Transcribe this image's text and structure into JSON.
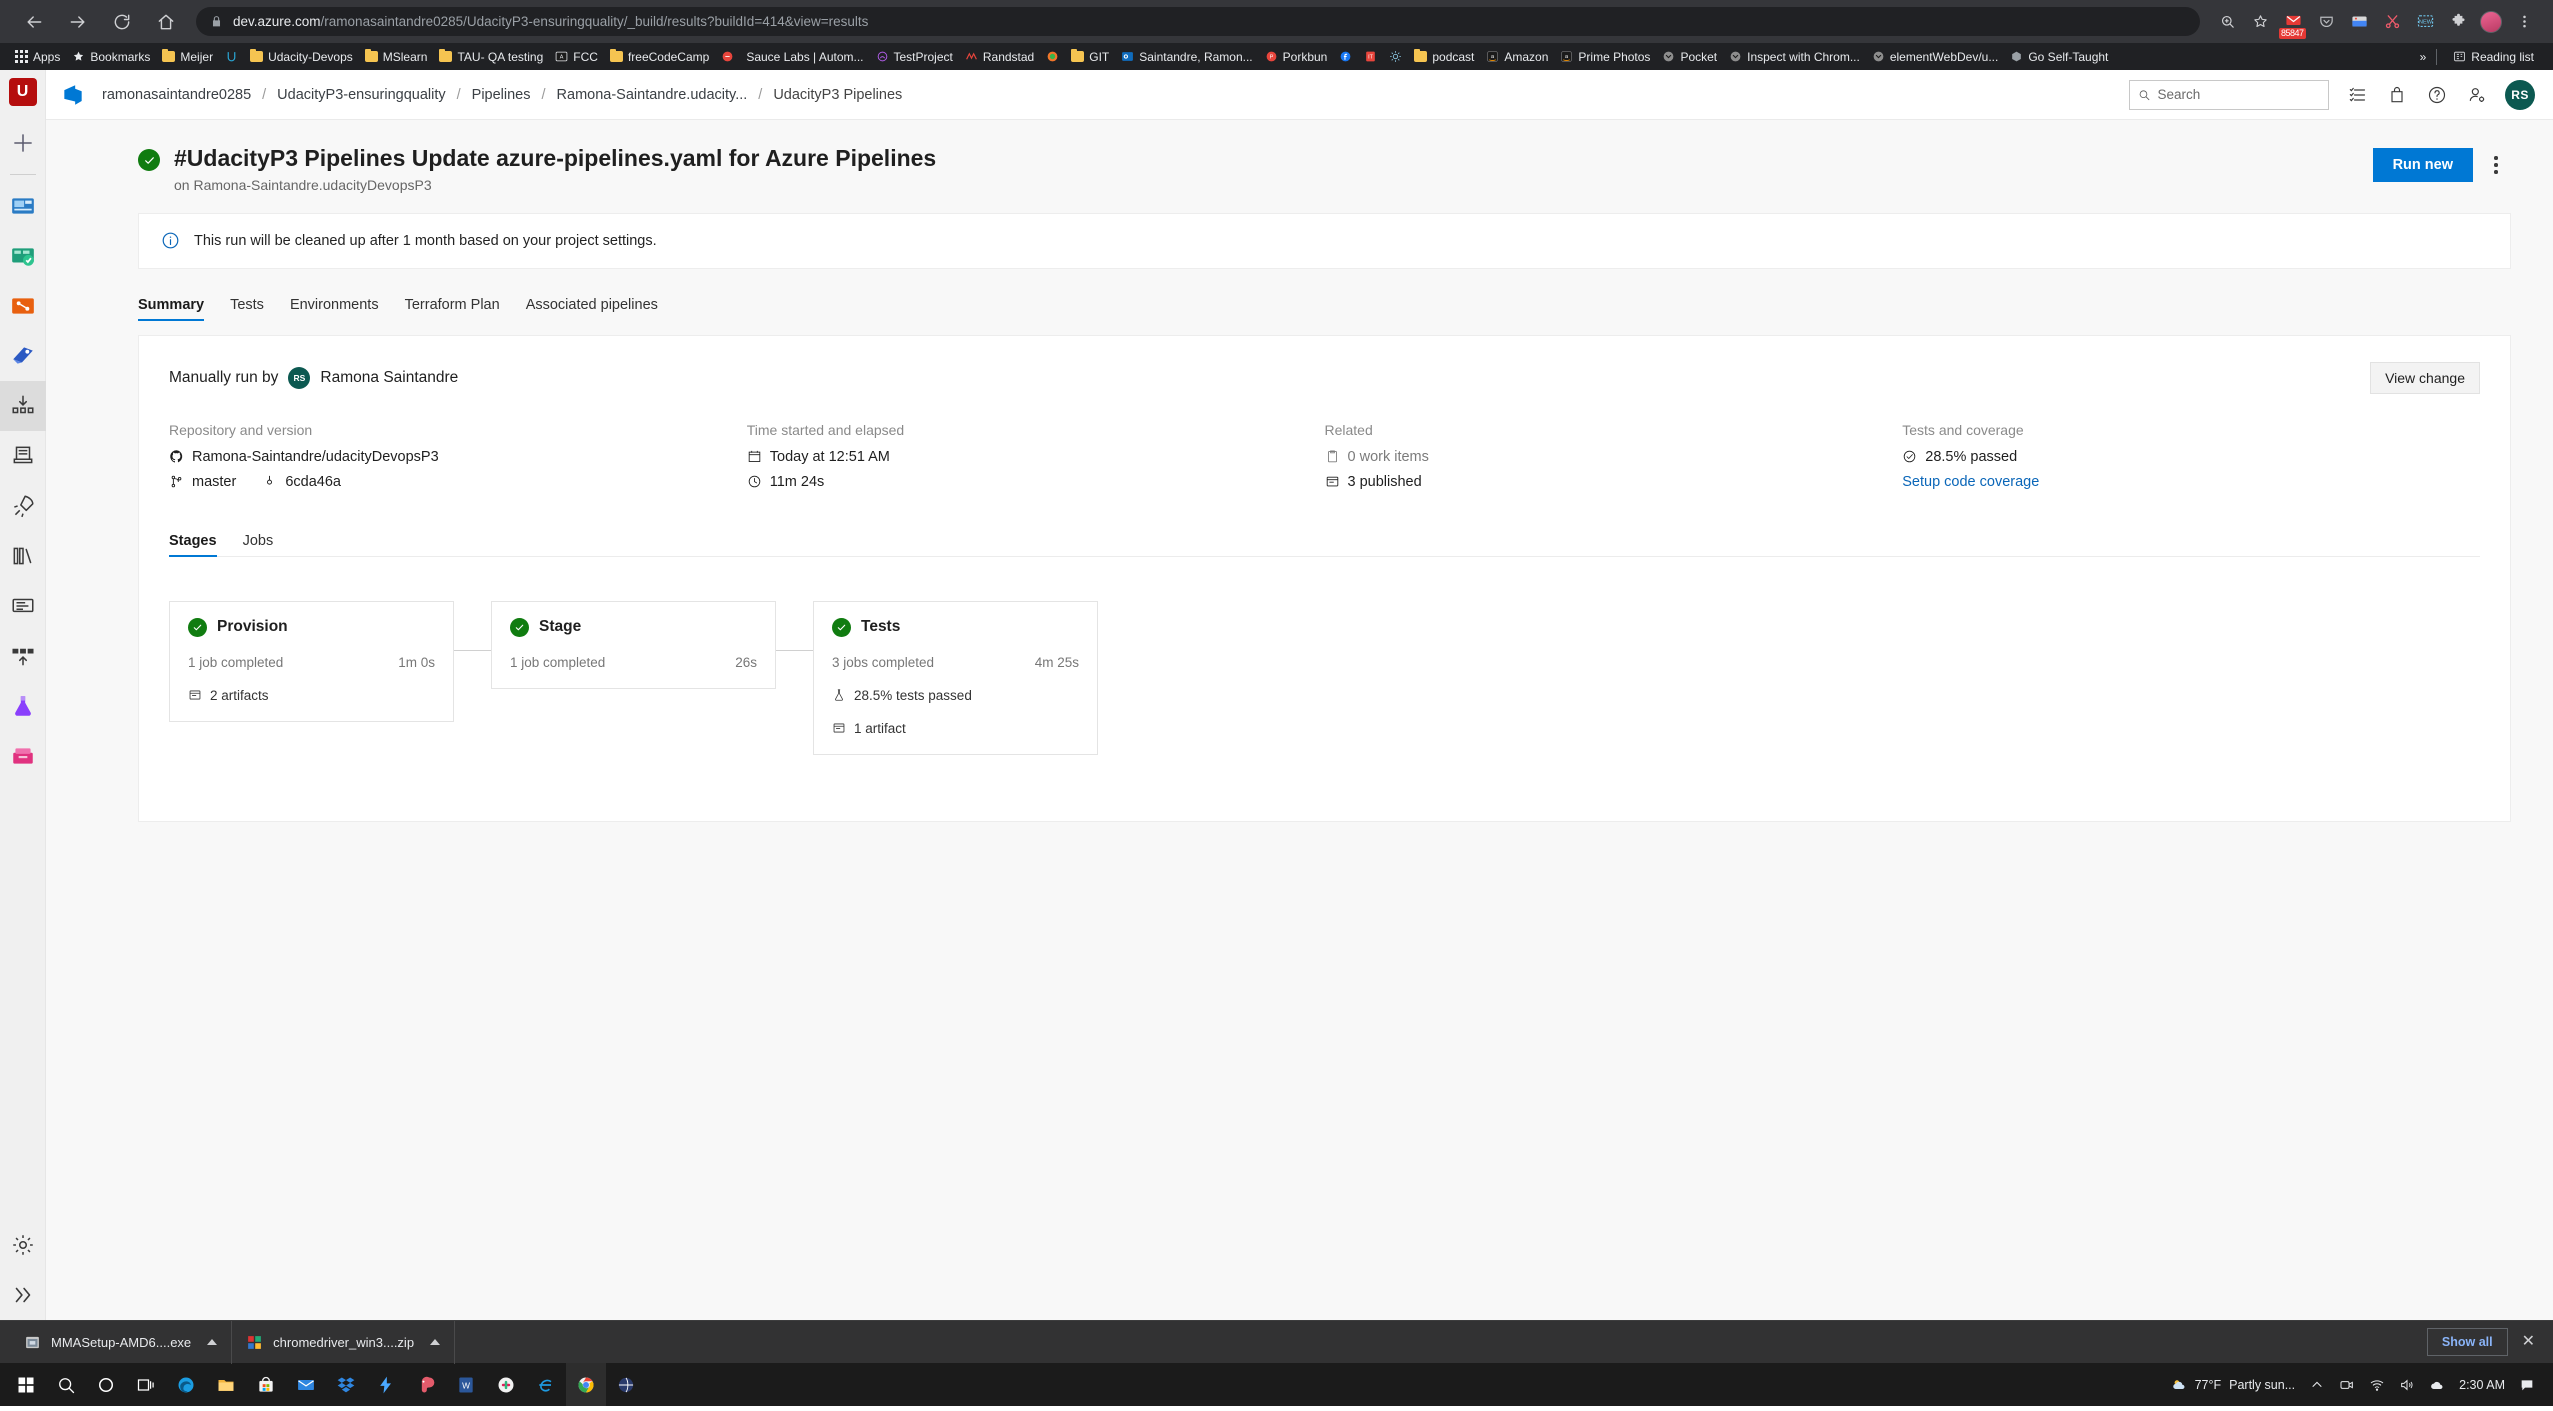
{
  "browser": {
    "url_host": "dev.azure.com",
    "url_path": "/ramonasaintandre0285/UdacityP3-ensuringquality/_build/results?buildId=414&view=results",
    "nav": {
      "back": "back-arrow",
      "forward": "forward-arrow",
      "reload": "reload",
      "home": "home"
    },
    "gmail_badge": "85847",
    "bookmarks": [
      {
        "label": "Apps",
        "icon": "apps-grid"
      },
      {
        "label": "Bookmarks",
        "icon": "star"
      },
      {
        "label": "Meijer",
        "icon": "folder"
      },
      {
        "label": "",
        "icon": "udacity"
      },
      {
        "label": "Udacity-Devops",
        "icon": "folder"
      },
      {
        "label": "MSlearn",
        "icon": "folder"
      },
      {
        "label": "TAU- QA testing",
        "icon": "folder"
      },
      {
        "label": "FCC",
        "icon": "fcc"
      },
      {
        "label": "freeCodeCamp",
        "icon": "folder"
      },
      {
        "label": "",
        "icon": "saucelabs"
      },
      {
        "label": "Sauce Labs | Autom...",
        "icon": "saucelabs"
      },
      {
        "label": "TestProject",
        "icon": "testproject"
      },
      {
        "label": "Randstad",
        "icon": "randstad"
      },
      {
        "label": "",
        "icon": "firefox"
      },
      {
        "label": "GIT",
        "icon": "folder"
      },
      {
        "label": "Saintandre, Ramon...",
        "icon": "outlook"
      },
      {
        "label": "Porkbun",
        "icon": "porkbun"
      },
      {
        "label": "",
        "icon": "facebook"
      },
      {
        "label": "",
        "icon": "it"
      },
      {
        "label": "",
        "icon": "gear-wheel"
      },
      {
        "label": "podcast",
        "icon": "folder"
      },
      {
        "label": "Amazon",
        "icon": "amazon"
      },
      {
        "label": "Prime Photos",
        "icon": "amazon"
      },
      {
        "label": "Pocket",
        "icon": "pocket"
      },
      {
        "label": "Inspect with Chrom...",
        "icon": "pocket"
      },
      {
        "label": "elementWebDev/u...",
        "icon": "pocket"
      },
      {
        "label": "Go Self-Taught",
        "icon": "cube"
      }
    ],
    "overflow_label": "»",
    "reading_list": "Reading list"
  },
  "rail": {
    "logo_letter": "U",
    "items": [
      {
        "name": "add-new",
        "icon": "plus"
      },
      {
        "name": "overview",
        "icon": "dashboard"
      },
      {
        "name": "boards",
        "icon": "boards"
      },
      {
        "name": "repos",
        "icon": "repos"
      },
      {
        "name": "pipelines",
        "icon": "pipelines"
      },
      {
        "name": "pipelines-runs",
        "icon": "pipeline-runs"
      },
      {
        "name": "environments",
        "icon": "environments"
      },
      {
        "name": "releases",
        "icon": "rocket"
      },
      {
        "name": "library",
        "icon": "library"
      },
      {
        "name": "task-groups",
        "icon": "task-groups"
      },
      {
        "name": "deployment-groups",
        "icon": "deployment-groups"
      },
      {
        "name": "test-plans",
        "icon": "flask"
      },
      {
        "name": "artifacts",
        "icon": "artifacts"
      }
    ],
    "settings": "gear-icon",
    "expand": "chevron-double-right"
  },
  "topbar": {
    "breadcrumbs": [
      "ramonasaintandre0285",
      "UdacityP3-ensuringquality",
      "Pipelines",
      "Ramona-Saintandre.udacity...",
      "UdacityP3 Pipelines"
    ],
    "separator": "/",
    "search_placeholder": "Search",
    "search_value": "",
    "icons": [
      "list-icon",
      "shopping-bag-icon",
      "help-icon",
      "user-settings-icon"
    ],
    "avatar_initials": "RS"
  },
  "page": {
    "status": "succeeded",
    "title": "#UdacityP3 Pipelines Update azure-pipelines.yaml for Azure Pipelines",
    "subtitle": "on Ramona-Saintandre.udacityDevopsP3",
    "run_new_label": "Run new",
    "info_message": "This run will be cleaned up after 1 month based on your project settings.",
    "tabs": [
      {
        "label": "Summary",
        "active": true
      },
      {
        "label": "Tests",
        "active": false
      },
      {
        "label": "Environments",
        "active": false
      },
      {
        "label": "Terraform Plan",
        "active": false
      },
      {
        "label": "Associated pipelines",
        "active": false
      }
    ]
  },
  "summary": {
    "run_by_prefix": "Manually run by",
    "run_by_initials": "RS",
    "run_by_name": "Ramona Saintandre",
    "view_change_label": "View change",
    "columns": [
      {
        "label": "Repository and version",
        "repo": "Ramona-Saintandre/udacityDevopsP3",
        "branch": "master",
        "commit": "6cda46a"
      },
      {
        "label": "Time started and elapsed",
        "started": "Today at 12:51 AM",
        "elapsed": "11m 24s"
      },
      {
        "label": "Related",
        "work_items": "0 work items",
        "published": "3 published"
      },
      {
        "label": "Tests and coverage",
        "tests": "28.5% passed",
        "coverage_link": "Setup code coverage"
      }
    ],
    "subtabs": [
      {
        "label": "Stages",
        "active": true
      },
      {
        "label": "Jobs",
        "active": false
      }
    ],
    "stages": [
      {
        "name": "Provision",
        "status": "succeeded",
        "jobs": "1 job completed",
        "duration": "1m 0s",
        "extras": [
          {
            "icon": "artifact-icon",
            "label": "2 artifacts"
          }
        ]
      },
      {
        "name": "Stage",
        "status": "succeeded",
        "jobs": "1 job completed",
        "duration": "26s",
        "extras": []
      },
      {
        "name": "Tests",
        "status": "succeeded",
        "jobs": "3 jobs completed",
        "duration": "4m 25s",
        "extras": [
          {
            "icon": "flask-icon",
            "label": "28.5% tests passed"
          },
          {
            "icon": "artifact-icon",
            "label": "1 artifact"
          }
        ]
      }
    ]
  },
  "shelf": {
    "downloads": [
      {
        "label": "MMASetup-AMD6....exe",
        "icon": "installer-icon"
      },
      {
        "label": "chromedriver_win3....zip",
        "icon": "winrar-icon"
      }
    ],
    "show_all_label": "Show all",
    "close_label": "✕"
  },
  "taskbar": {
    "items": [
      "start-icon",
      "search-icon",
      "cortana-icon",
      "task-view-icon",
      "edge-icon",
      "file-explorer-icon",
      "microsoft-store-icon",
      "mail-icon",
      "dropbox-icon",
      "lightning-icon",
      "paint-icon",
      "word-icon",
      "slack-icon",
      "internet-explorer-icon",
      "chrome-icon",
      "globe-icon"
    ],
    "weather_temp": "77°F",
    "weather_desc": "Partly sun...",
    "clock": "2:30 AM",
    "tray_icons": [
      "chevron-up-icon",
      "meet-icon",
      "wifi-icon",
      "volume-icon",
      "onedrive-icon"
    ],
    "notification_icon": "notification-icon"
  },
  "colors": {
    "accent": "#0078d4",
    "success": "#107c10",
    "link": "#0a66b8",
    "avatar": "#0c5951",
    "chrome_bg": "#202124"
  }
}
